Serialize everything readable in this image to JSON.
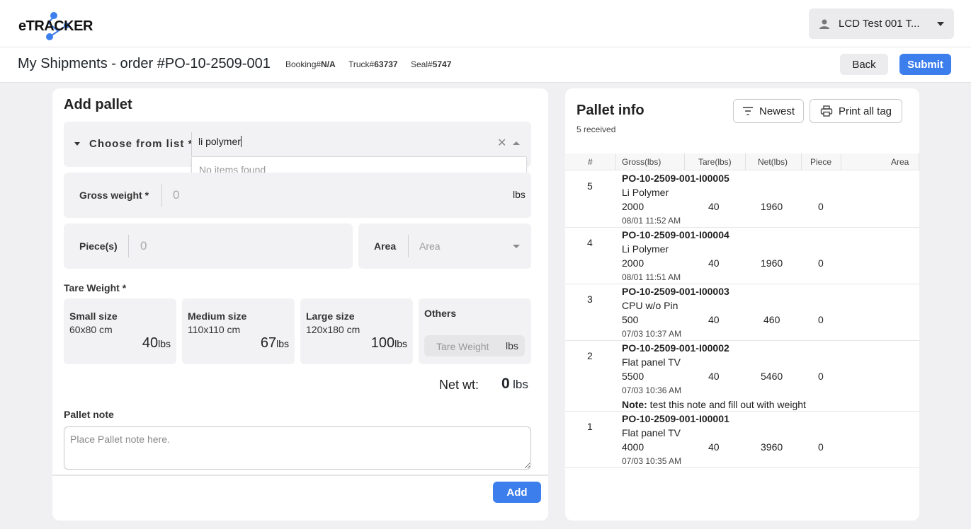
{
  "header": {
    "logo_text": "eTRACKER",
    "user_label": "LCD Test 001 T..."
  },
  "subheader": {
    "title": "My Shipments - order #PO-10-2509-001",
    "booking_label": "Booking#",
    "booking_value": "N/A",
    "truck_label": "Truck#",
    "truck_value": "63737",
    "seal_label": "Seal#",
    "seal_value": "5747",
    "back_label": "Back",
    "submit_label": "Submit"
  },
  "form": {
    "title": "Add pallet",
    "choose_label": "Choose from list *",
    "search_value": "li polymer",
    "no_items_text": "No items found",
    "gross_label": "Gross weight *",
    "gross_value": "0",
    "gross_unit": "lbs",
    "pieces_label": "Piece(s)",
    "pieces_value": "0",
    "area_label": "Area",
    "area_placeholder": "Area",
    "tare_title": "Tare Weight *",
    "tare_options": [
      {
        "name": "Small size",
        "dims": "60x80 cm",
        "value": "40",
        "unit": "lbs"
      },
      {
        "name": "Medium size",
        "dims": "110x110 cm",
        "value": "67",
        "unit": "lbs"
      },
      {
        "name": "Large size",
        "dims": "120x180 cm",
        "value": "100",
        "unit": "lbs"
      }
    ],
    "others_label": "Others",
    "others_placeholder": "Tare Weight",
    "others_unit": "lbs",
    "net_label": "Net wt:",
    "net_value": "0",
    "net_unit": "lbs",
    "note_label": "Pallet note",
    "note_placeholder": "Place Pallet note here.",
    "add_label": "Add"
  },
  "pallet_info": {
    "title": "Pallet info",
    "count_text": "5 received",
    "sort_label": "Newest",
    "print_label": "Print all tag",
    "columns": [
      "#",
      "Gross(lbs)",
      "Tare(lbs)",
      "Net(lbs)",
      "Piece",
      "Area"
    ],
    "rows": [
      {
        "num": "5",
        "id": "PO-10-2509-001-I00005",
        "product": "Li Polymer",
        "gross": "2000",
        "tare": "40",
        "net": "1960",
        "piece": "0",
        "time": "08/01 11:52 AM"
      },
      {
        "num": "4",
        "id": "PO-10-2509-001-I00004",
        "product": "Li Polymer",
        "gross": "2000",
        "tare": "40",
        "net": "1960",
        "piece": "0",
        "time": "08/01 11:51 AM"
      },
      {
        "num": "3",
        "id": "PO-10-2509-001-I00003",
        "product": "CPU w/o Pin",
        "gross": "500",
        "tare": "40",
        "net": "460",
        "piece": "0",
        "time": "07/03 10:37 AM"
      },
      {
        "num": "2",
        "id": "PO-10-2509-001-I00002",
        "product": "Flat panel TV",
        "gross": "5500",
        "tare": "40",
        "net": "5460",
        "piece": "0",
        "time": "07/03 10:36 AM",
        "note_label": "Note:",
        "note_text": "test this note and fill out with weight"
      },
      {
        "num": "1",
        "id": "PO-10-2509-001-I00001",
        "product": "Flat panel TV",
        "gross": "4000",
        "tare": "40",
        "net": "3960",
        "piece": "0",
        "time": "07/03 10:35 AM"
      }
    ]
  },
  "colors": {
    "primary": "#3d7eed",
    "page_bg": "#f0f0f2",
    "field_bg": "#f2f2f4",
    "logo_dot": "#3d7eed"
  }
}
